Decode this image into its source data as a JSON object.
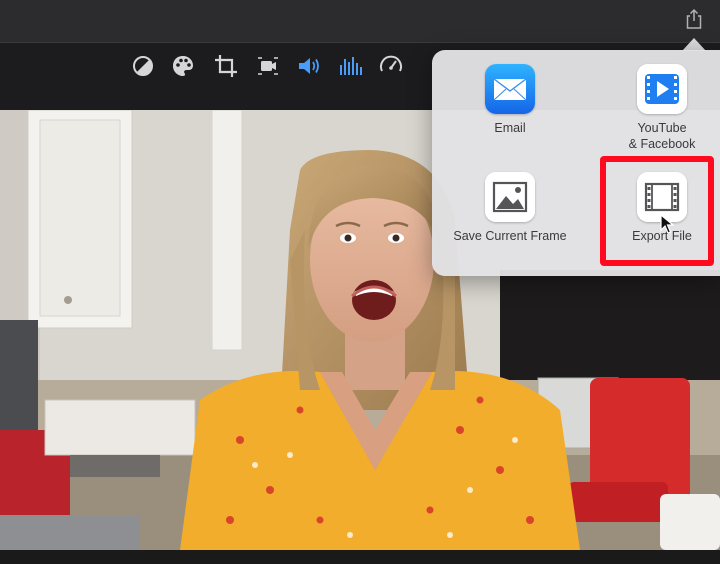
{
  "share_menu": {
    "items": [
      {
        "label": "Email",
        "icon": "email-icon"
      },
      {
        "label": "YouTube\n& Facebook",
        "icon": "youtube-facebook-icon"
      },
      {
        "label": "Save Current Frame",
        "icon": "save-frame-icon"
      },
      {
        "label": "Export File",
        "icon": "export-file-icon"
      }
    ]
  },
  "toolbar": {
    "tools": [
      "color-balance-icon",
      "color-correction-icon",
      "crop-icon",
      "stabilization-icon",
      "volume-icon",
      "noise-equalizer-icon",
      "speed-icon"
    ],
    "active_tool": "volume-icon",
    "accent_color": "#4a9cf6"
  },
  "highlight_color": "#ff0a1e"
}
